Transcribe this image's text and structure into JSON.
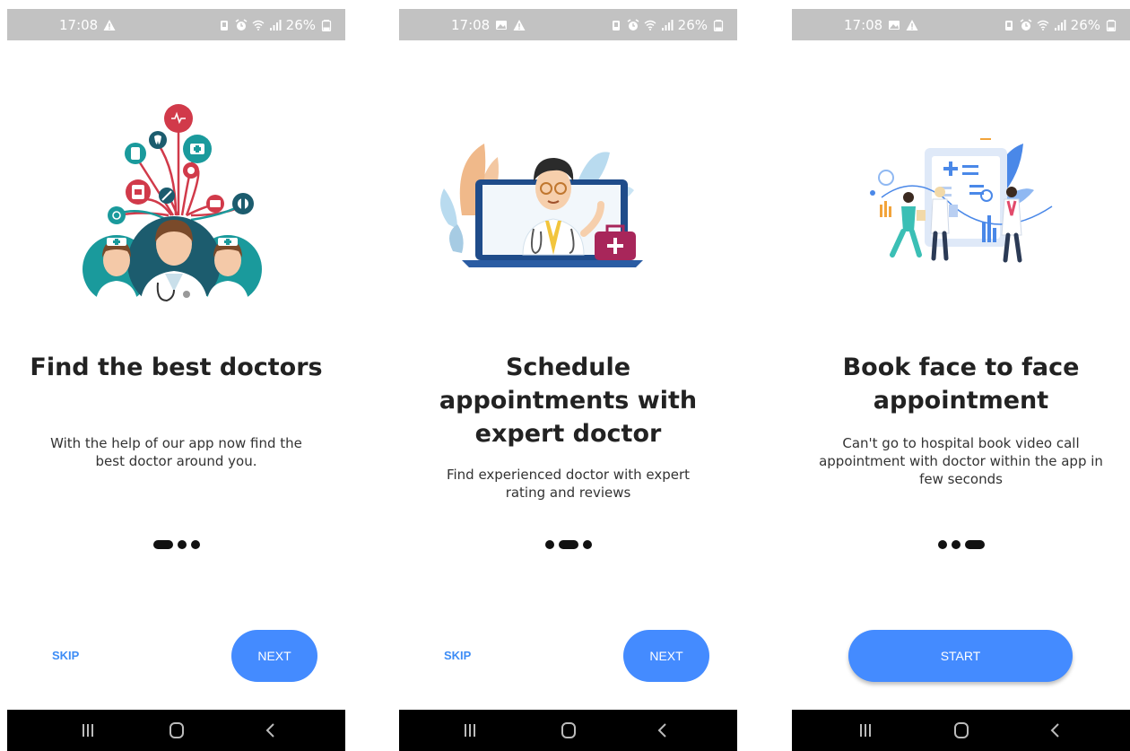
{
  "status_bar": {
    "time": "17:08",
    "battery": "26%"
  },
  "screens": [
    {
      "title": "Find the best doctors",
      "description": "With the help of our app now find the best doctor around you.",
      "active_dot": 0,
      "skip_label": "SKIP",
      "next_label": "NEXT",
      "illustration": "doctors-network-illustration"
    },
    {
      "title": "Schedule appointments with expert doctor",
      "description": "Find experienced doctor with expert rating and reviews",
      "active_dot": 1,
      "skip_label": "SKIP",
      "next_label": "NEXT",
      "illustration": "video-doctor-laptop-illustration"
    },
    {
      "title": "Book face to face appointment",
      "description": "Can't go to hospital book video call appointment with doctor within the app in few seconds",
      "active_dot": 2,
      "start_label": "START",
      "illustration": "medical-team-chart-illustration"
    }
  ],
  "colors": {
    "accent": "#448bff",
    "skip": "#3d8cf5",
    "teal": "#1a9a9c",
    "red": "#d13a4a",
    "dark_teal": "#1c5c6e"
  },
  "icons": [
    "warning-icon",
    "image-icon",
    "vibrate-icon",
    "alarm-icon",
    "wifi-icon",
    "signal-icon",
    "battery-icon",
    "recents-icon",
    "home-icon",
    "back-icon"
  ]
}
